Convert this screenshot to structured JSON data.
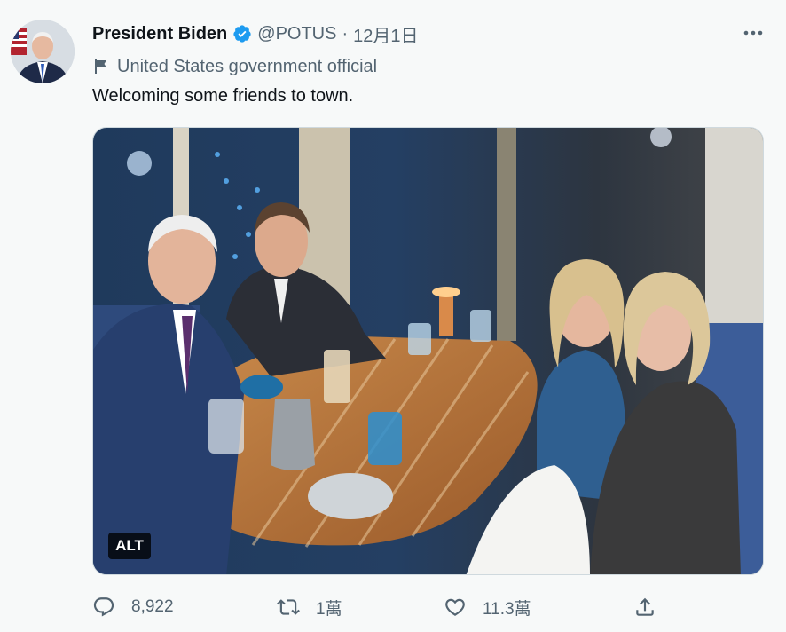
{
  "tweet": {
    "author_name": "President Biden",
    "handle": "@POTUS",
    "separator": "·",
    "date": "12月1日",
    "label": "United States government official",
    "text": "Welcoming some friends to town.",
    "alt_badge": "ALT",
    "stats": {
      "replies": "8,922",
      "retweets": "1萬",
      "likes": "11.3萬"
    }
  },
  "icons": {
    "verified": "verified-badge-icon",
    "more": "more-horizontal-icon",
    "label": "flag-icon",
    "reply": "reply-icon",
    "retweet": "retweet-icon",
    "like": "heart-icon",
    "share": "share-upload-icon"
  },
  "colors": {
    "background": "#f7f9f9",
    "text_primary": "#0f1419",
    "text_secondary": "#536471",
    "verified_blue": "#1d9bf0"
  }
}
